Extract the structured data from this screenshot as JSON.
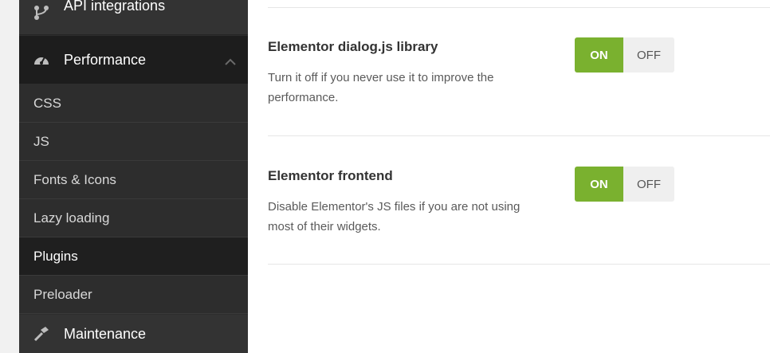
{
  "sidebar": {
    "api_integrations": {
      "label": "API integrations",
      "icon": "branch-icon"
    },
    "performance": {
      "label": "Performance",
      "icon": "speedometer-icon"
    },
    "sub_items": [
      "CSS",
      "JS",
      "Fonts & Icons",
      "Lazy loading",
      "Plugins",
      "Preloader"
    ],
    "active_sub_item": "Plugins",
    "maintenance": {
      "label": "Maintenance",
      "icon": "hammer-icon"
    }
  },
  "options": [
    {
      "title": "Elementor dialog.js library",
      "description": "Turn it off if you never use it to improve the performance.",
      "on_label": "ON",
      "off_label": "OFF",
      "state": "on"
    },
    {
      "title": "Elementor frontend",
      "description": "Disable Elementor's JS files if you are not using most of their widgets.",
      "on_label": "ON",
      "off_label": "OFF",
      "state": "on"
    }
  ],
  "colors": {
    "accent_green": "#7ab12f",
    "sidebar_bg": "#2d2d2d",
    "sidebar_active_bg": "#1d1d1d"
  }
}
